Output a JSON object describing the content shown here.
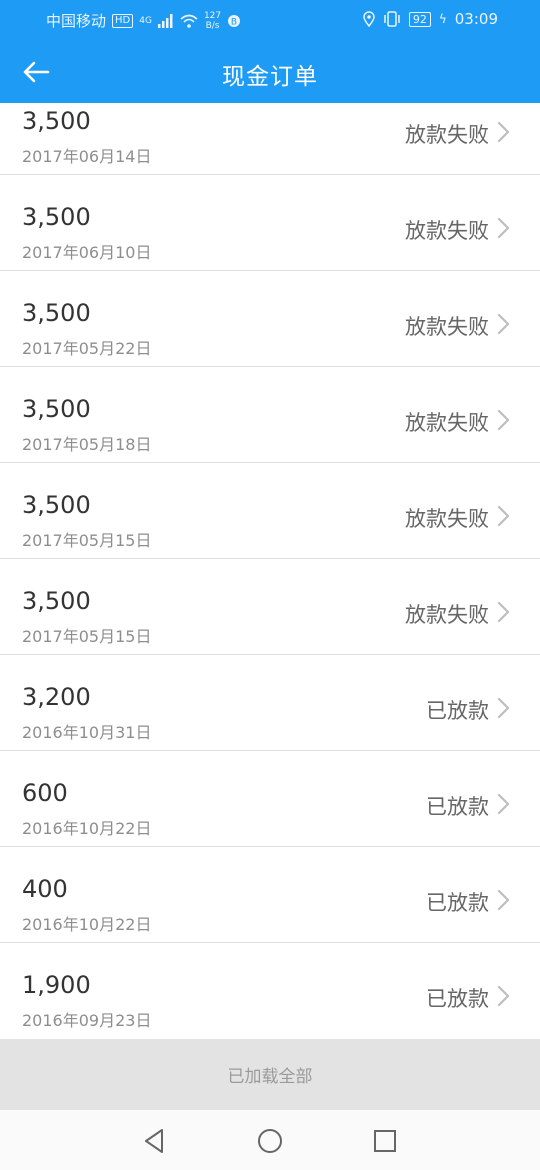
{
  "status_bar": {
    "carrier": "中国移动",
    "hd_badge": "HD",
    "network": "4G",
    "speed_value": "127",
    "speed_unit": "B/s",
    "battery": "92",
    "time": "03:09"
  },
  "header": {
    "title": "现金订单"
  },
  "orders": [
    {
      "amount": "3,500",
      "date": "2017年06月14日",
      "status": "放款失败"
    },
    {
      "amount": "3,500",
      "date": "2017年06月10日",
      "status": "放款失败"
    },
    {
      "amount": "3,500",
      "date": "2017年05月22日",
      "status": "放款失败"
    },
    {
      "amount": "3,500",
      "date": "2017年05月18日",
      "status": "放款失败"
    },
    {
      "amount": "3,500",
      "date": "2017年05月15日",
      "status": "放款失败"
    },
    {
      "amount": "3,500",
      "date": "2017年05月15日",
      "status": "放款失败"
    },
    {
      "amount": "3,200",
      "date": "2016年10月31日",
      "status": "已放款"
    },
    {
      "amount": "600",
      "date": "2016年10月22日",
      "status": "已放款"
    },
    {
      "amount": "400",
      "date": "2016年10月22日",
      "status": "已放款"
    },
    {
      "amount": "1,900",
      "date": "2016年09月23日",
      "status": "已放款"
    }
  ],
  "footer": {
    "loaded_all": "已加载全部"
  },
  "colors": {
    "accent": "#1E9BF5",
    "divider": "#dedede",
    "footer_bg": "#e3e3e3"
  }
}
